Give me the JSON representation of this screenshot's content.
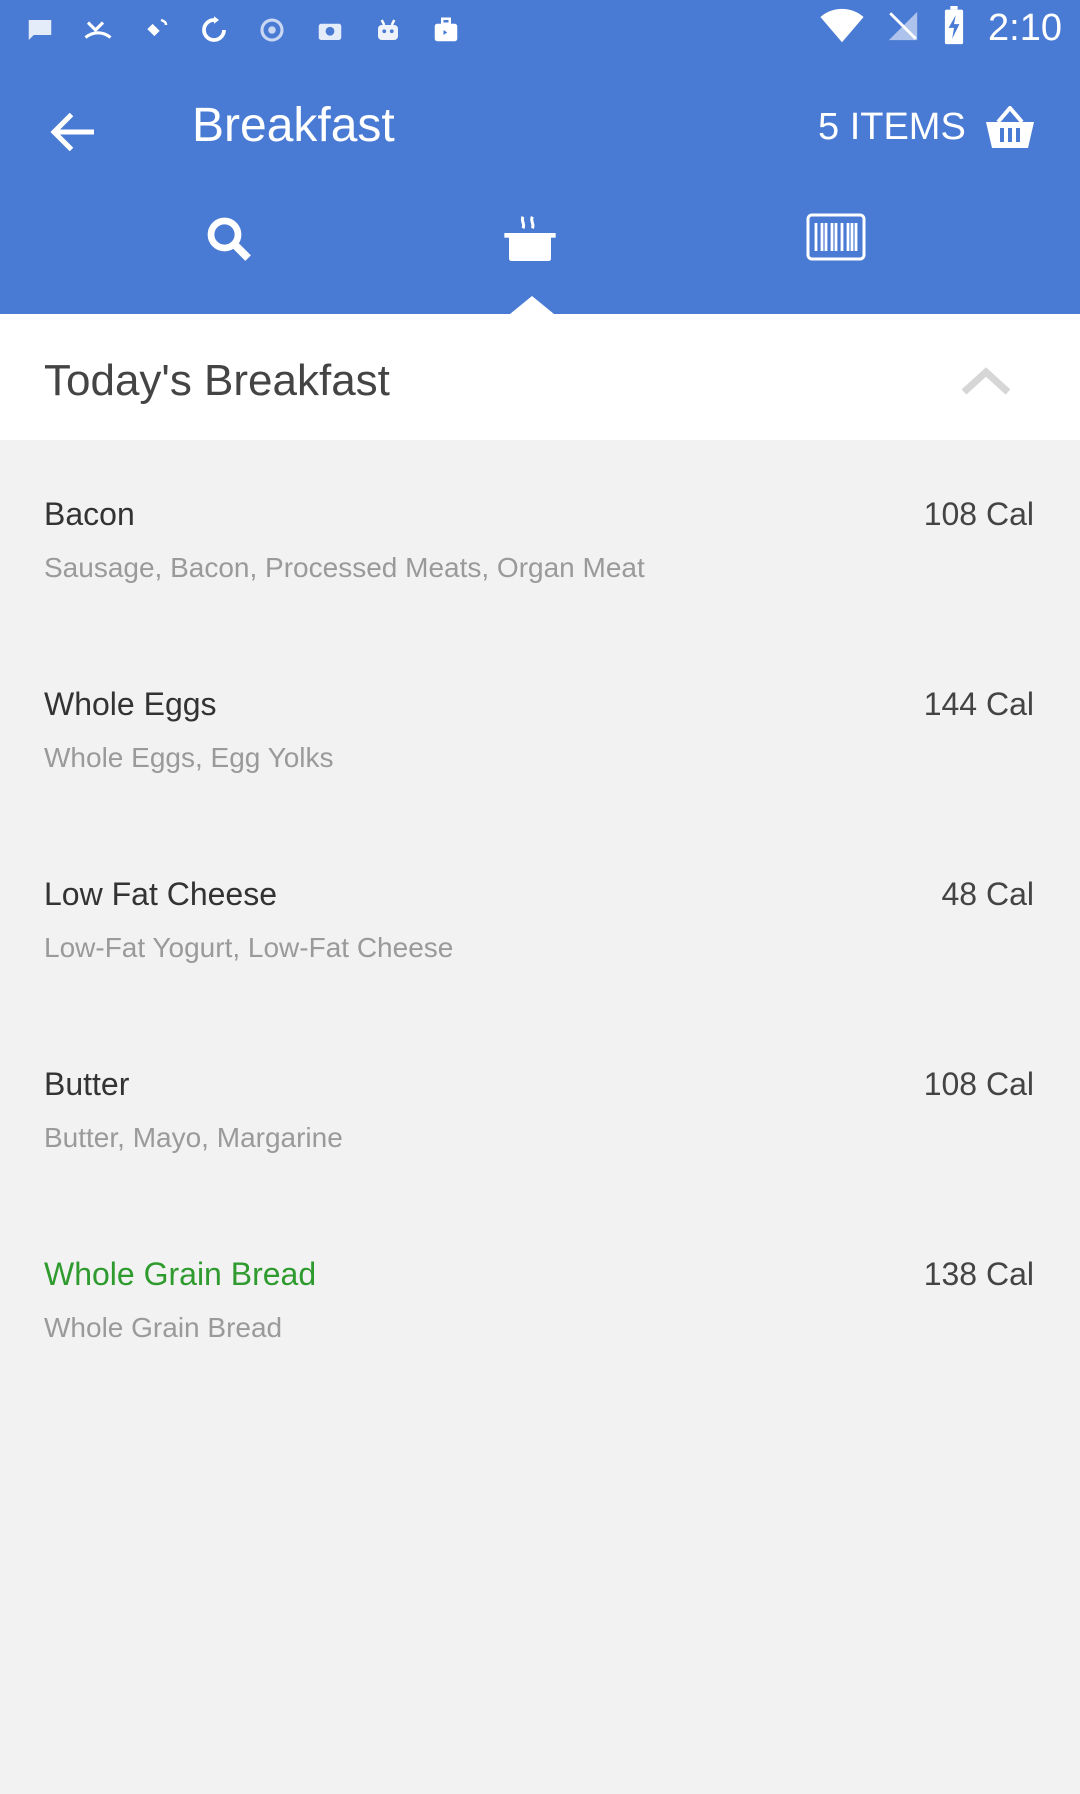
{
  "status_bar": {
    "time": "2:10",
    "icons": [
      "message-icon",
      "missed-call-icon",
      "satellite-icon",
      "sync-icon",
      "settings-icon",
      "camera-icon",
      "android-icon",
      "briefcase-icon",
      "wifi-icon",
      "no-signal-icon",
      "battery-charging-icon"
    ]
  },
  "header": {
    "title": "Breakfast",
    "items_count": "5 ITEMS",
    "tools": [
      "search-icon",
      "pot-icon",
      "barcode-icon"
    ]
  },
  "section": {
    "title": "Today's Breakfast"
  },
  "food_items": [
    {
      "name": "Bacon",
      "description": "Sausage, Bacon, Processed Meats, Organ Meat",
      "calories": "108 Cal",
      "highlight": false
    },
    {
      "name": "Whole Eggs",
      "description": "Whole Eggs, Egg Yolks",
      "calories": "144 Cal",
      "highlight": false
    },
    {
      "name": "Low Fat Cheese",
      "description": "Low-Fat Yogurt, Low-Fat Cheese",
      "calories": "48 Cal",
      "highlight": false
    },
    {
      "name": "Butter",
      "description": "Butter, Mayo, Margarine",
      "calories": "108 Cal",
      "highlight": false
    },
    {
      "name": "Whole Grain Bread",
      "description": "Whole Grain Bread",
      "calories": "138 Cal",
      "highlight": true
    }
  ],
  "colors": {
    "header_blue": "#4a7bd4",
    "highlight_green": "#2f9b2f"
  }
}
